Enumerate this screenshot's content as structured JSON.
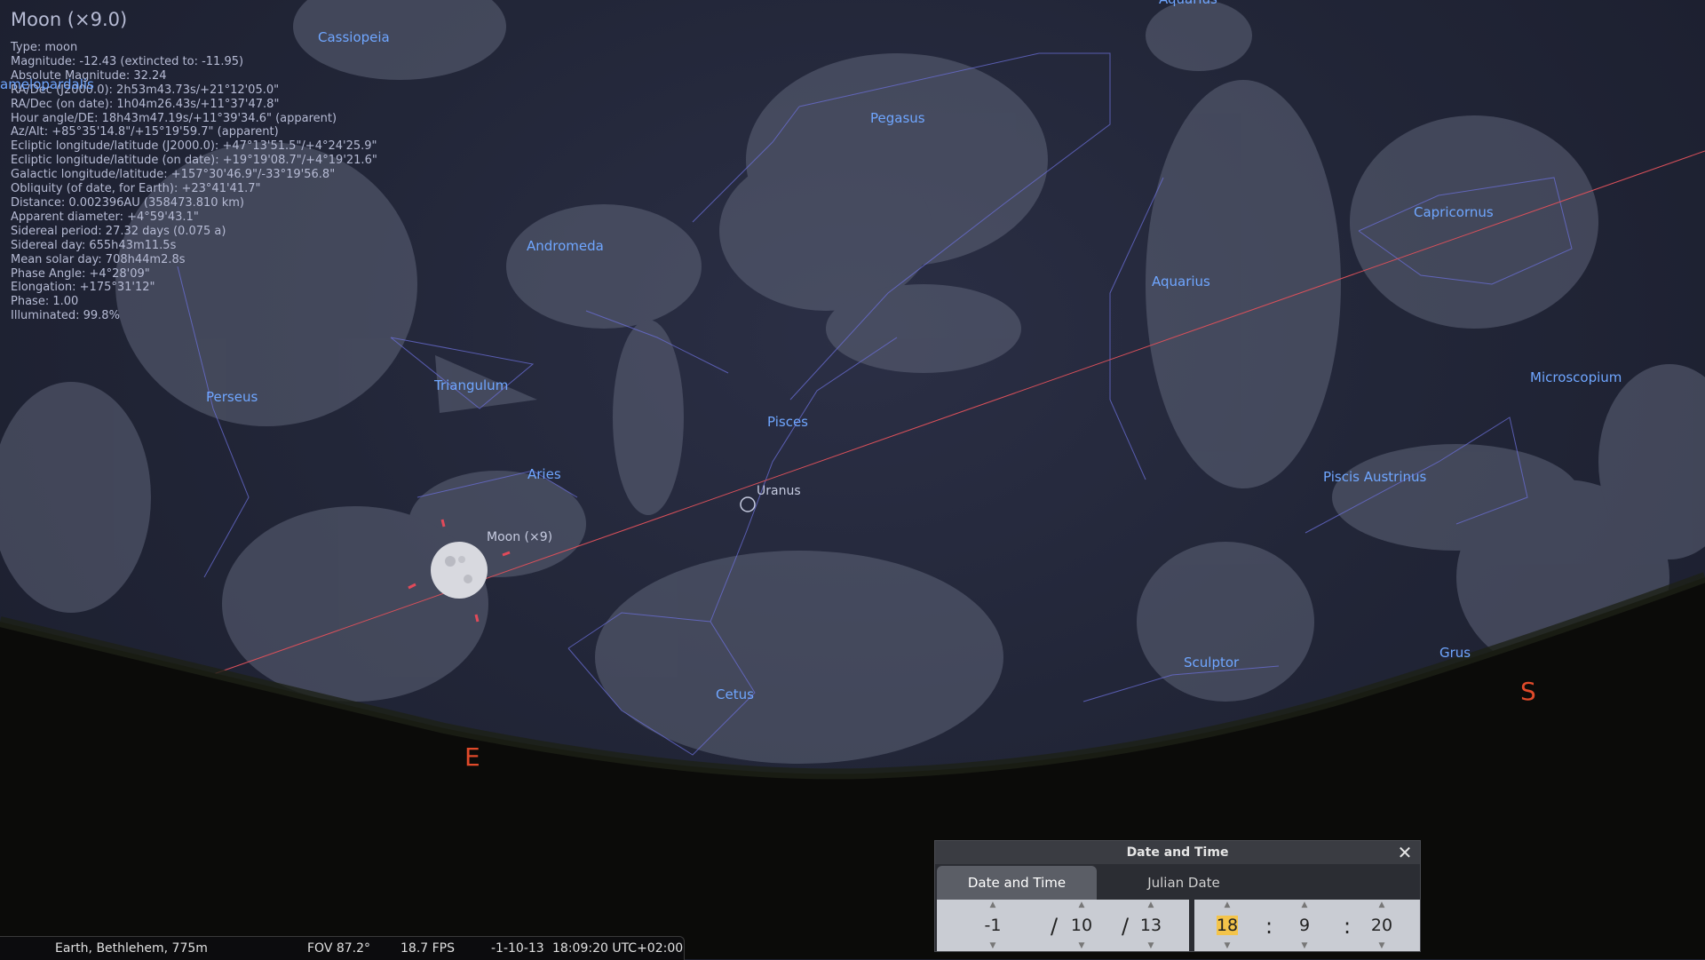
{
  "info": {
    "title": "Moon (×9.0)",
    "lines": [
      "Type: moon",
      "Magnitude: -12.43 (extincted to: -11.95)",
      "Absolute Magnitude: 32.24",
      "RA/Dec (J2000.0): 2h53m43.73s/+21°12'05.0\"",
      "RA/Dec (on date): 1h04m26.43s/+11°37'47.8\"",
      "Hour angle/DE: 18h43m47.19s/+11°39'34.6\" (apparent)",
      "Az/Alt: +85°35'14.8\"/+15°19'59.7\" (apparent)",
      "Ecliptic longitude/latitude (J2000.0): +47°13'51.5\"/+4°24'25.9\"",
      "Ecliptic longitude/latitude (on date): +19°19'08.7\"/+4°19'21.6\"",
      "Galactic longitude/latitude: +157°30'46.9\"/-33°19'56.8\"",
      "Obliquity (of date, for Earth): +23°41'41.7\"",
      "Distance: 0.002396AU (358473.810 km)",
      "Apparent diameter: +4°59'43.1\"",
      "Sidereal period: 27.32 days (0.075 a)",
      "Sidereal day: 655h43m11.5s",
      "Mean solar day: 708h44m2.8s",
      "Phase Angle: +4°28'09\"",
      "Elongation: +175°31'12\"",
      "Phase: 1.00",
      "Illuminated: 99.8%"
    ]
  },
  "constellations": {
    "cassiopeia": "Cassiopeia",
    "camelopardalis": "amelopardalis",
    "aquarius_top": "Aquarius",
    "pegasus": "Pegasus",
    "capricornus": "Capricornus",
    "andromeda": "Andromeda",
    "aquarius": "Aquarius",
    "microscopium": "Microscopium",
    "perseus": "Perseus",
    "triangulum": "Triangulum",
    "pisces": "Pisces",
    "aries": "Aries",
    "piscis_austrinus": "Piscis Austrinus",
    "sculptor": "Sculptor",
    "grus": "Grus",
    "cetus": "Cetus"
  },
  "objects": {
    "uranus": "Uranus",
    "moon": "Moon (×9)"
  },
  "cardinals": {
    "east": "E",
    "south": "S"
  },
  "dialog": {
    "title": "Date and Time",
    "close": "✕",
    "tabs": [
      "Date and Time",
      "Julian Date"
    ],
    "year": "-1",
    "month": "10",
    "day": "13",
    "hour": "18",
    "minute": "9",
    "second": "20",
    "date_sep": "/",
    "time_sep": ":"
  },
  "status": {
    "location": "Earth, Bethlehem, 775m",
    "fov": "FOV 87.2°",
    "fps": "18.7 FPS",
    "date": "-1-10-13",
    "time": "18:09:20 UTC+02:00"
  },
  "colors": {
    "constellation_label": "#6fa6ff",
    "ecliptic": "#d9505a",
    "cardinal": "#e04a2a",
    "ground": "#0a0a08"
  }
}
